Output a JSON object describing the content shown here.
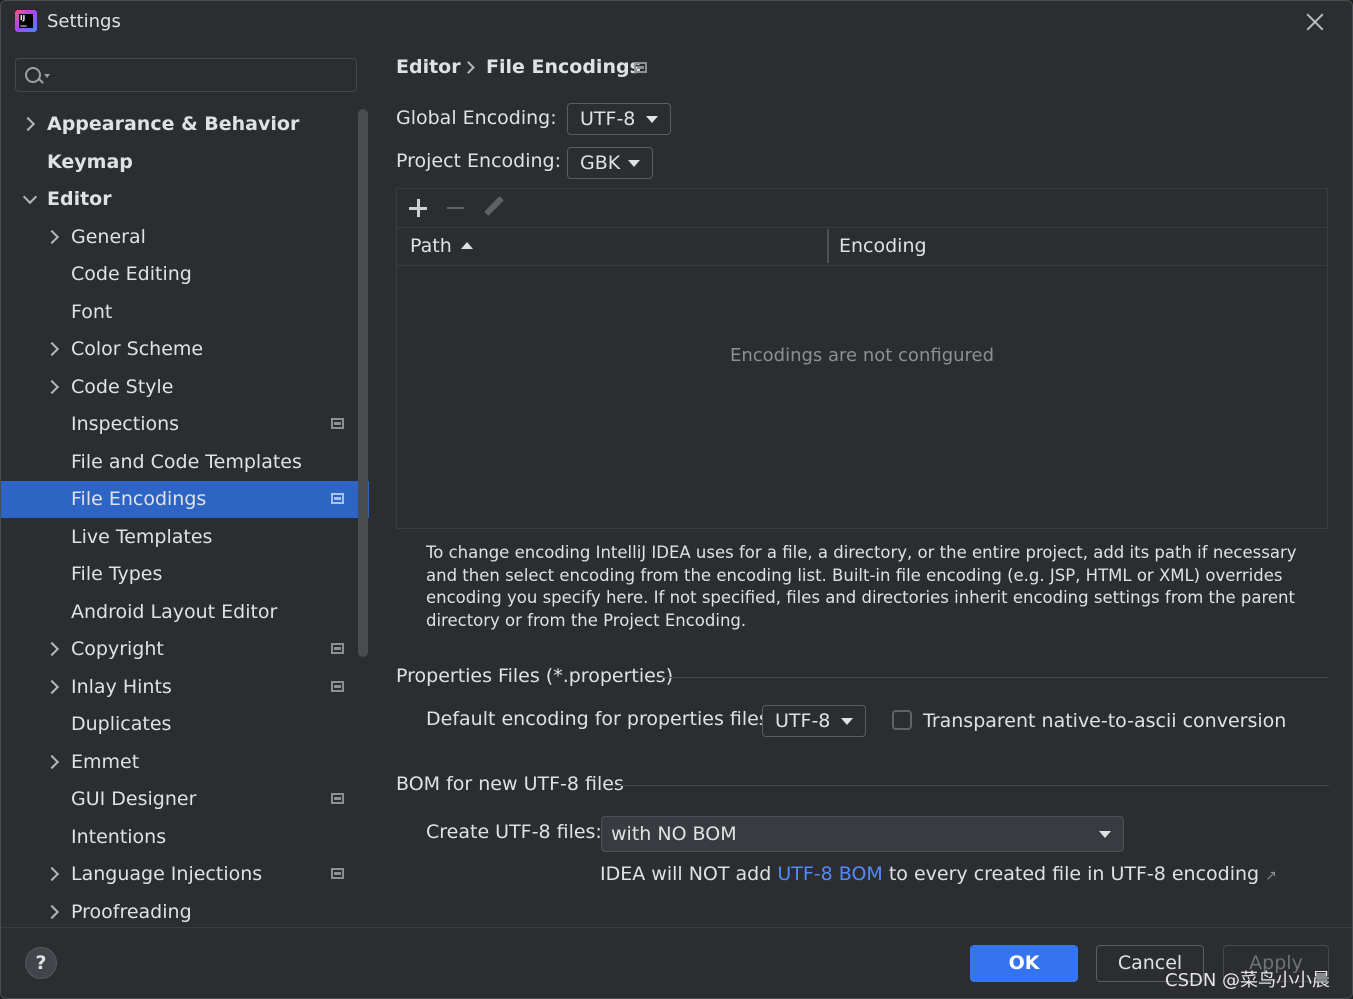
{
  "window": {
    "title": "Settings",
    "app_icon": "intellij-idea-icon"
  },
  "sidebar": {
    "search_placeholder": "",
    "items": [
      {
        "label": "Appearance & Behavior",
        "level": 0,
        "expander": "collapsed",
        "project_icon": false,
        "bold": true
      },
      {
        "label": "Keymap",
        "level": 0,
        "expander": "none",
        "project_icon": false,
        "bold": true
      },
      {
        "label": "Editor",
        "level": 0,
        "expander": "expanded",
        "project_icon": false,
        "bold": true
      },
      {
        "label": "General",
        "level": 1,
        "expander": "collapsed",
        "project_icon": false
      },
      {
        "label": "Code Editing",
        "level": 1,
        "expander": "none",
        "project_icon": false
      },
      {
        "label": "Font",
        "level": 1,
        "expander": "none",
        "project_icon": false
      },
      {
        "label": "Color Scheme",
        "level": 1,
        "expander": "collapsed",
        "project_icon": false
      },
      {
        "label": "Code Style",
        "level": 1,
        "expander": "collapsed",
        "project_icon": false
      },
      {
        "label": "Inspections",
        "level": 1,
        "expander": "none",
        "project_icon": true
      },
      {
        "label": "File and Code Templates",
        "level": 1,
        "expander": "none",
        "project_icon": false
      },
      {
        "label": "File Encodings",
        "level": 1,
        "expander": "none",
        "project_icon": true,
        "selected": true
      },
      {
        "label": "Live Templates",
        "level": 1,
        "expander": "none",
        "project_icon": false
      },
      {
        "label": "File Types",
        "level": 1,
        "expander": "none",
        "project_icon": false
      },
      {
        "label": "Android Layout Editor",
        "level": 1,
        "expander": "none",
        "project_icon": false
      },
      {
        "label": "Copyright",
        "level": 1,
        "expander": "collapsed",
        "project_icon": true
      },
      {
        "label": "Inlay Hints",
        "level": 1,
        "expander": "collapsed",
        "project_icon": true
      },
      {
        "label": "Duplicates",
        "level": 1,
        "expander": "none",
        "project_icon": false
      },
      {
        "label": "Emmet",
        "level": 1,
        "expander": "collapsed",
        "project_icon": false
      },
      {
        "label": "GUI Designer",
        "level": 1,
        "expander": "none",
        "project_icon": true
      },
      {
        "label": "Intentions",
        "level": 1,
        "expander": "none",
        "project_icon": false
      },
      {
        "label": "Language Injections",
        "level": 1,
        "expander": "collapsed",
        "project_icon": true
      },
      {
        "label": "Proofreading",
        "level": 1,
        "expander": "collapsed",
        "project_icon": false
      }
    ]
  },
  "breadcrumb": {
    "parent": "Editor",
    "current": "File Encodings"
  },
  "global_encoding": {
    "label": "Global Encoding:",
    "value": "UTF-8"
  },
  "project_encoding": {
    "label": "Project Encoding:",
    "value": "GBK"
  },
  "table": {
    "columns": [
      "Path",
      "Encoding"
    ],
    "sorted_column": "Path",
    "sort_direction": "ascending",
    "empty_text": "Encodings are not configured",
    "rows": []
  },
  "description": "To change encoding IntelliJ IDEA uses for a file, a directory, or the entire project, add its path if necessary and then select encoding from the encoding list. Built-in file encoding (e.g. JSP, HTML or XML) overrides encoding you specify here. If not specified, files and directories inherit encoding settings from the parent directory or from the Project Encoding.",
  "properties_section": {
    "title": "Properties Files (*.properties)",
    "default_label": "Default encoding for properties files:",
    "default_value": "UTF-8",
    "transparent_label": "Transparent native-to-ascii conversion",
    "transparent_checked": false
  },
  "bom_section": {
    "title": "BOM for new UTF-8 files",
    "create_label": "Create UTF-8 files:",
    "create_value": "with NO BOM",
    "info_prefix": "IDEA will NOT add",
    "info_link": "UTF-8 BOM",
    "info_suffix": "to every created file in UTF-8 encoding"
  },
  "buttons": {
    "help": "?",
    "ok": "OK",
    "cancel": "Cancel",
    "apply": "Apply"
  },
  "watermark": "CSDN @菜鸟小小晨",
  "colors": {
    "accent": "#3574f0",
    "selection": "#2e65c4",
    "link": "#548af7",
    "background": "#2b2d30"
  }
}
